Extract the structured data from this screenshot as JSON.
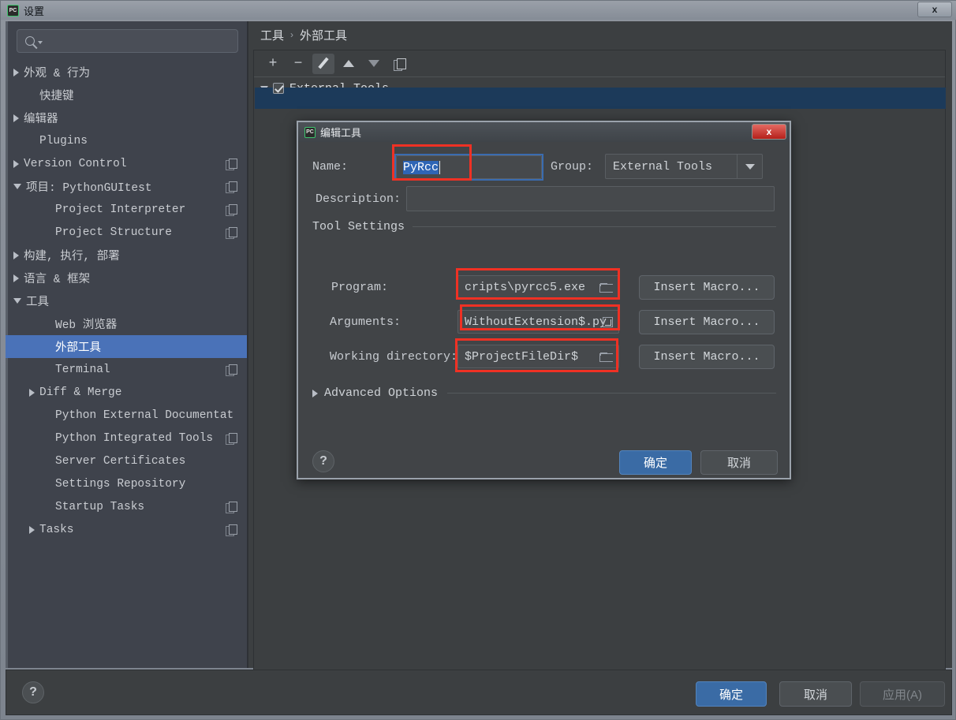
{
  "window": {
    "title": "设置",
    "close_label": "x",
    "app_icon": "PC"
  },
  "sidebar": {
    "search": {
      "placeholder": "",
      "value": ""
    },
    "items": [
      {
        "label": "外观 & 行为",
        "arrow": "right",
        "indent": 0,
        "copy": false,
        "selected": false
      },
      {
        "label": "快捷键",
        "arrow": "none",
        "indent": 1,
        "copy": false,
        "selected": false
      },
      {
        "label": "编辑器",
        "arrow": "right",
        "indent": 0,
        "copy": false,
        "selected": false
      },
      {
        "label": "Plugins",
        "arrow": "none",
        "indent": 1,
        "copy": false,
        "selected": false
      },
      {
        "label": "Version Control",
        "arrow": "right",
        "indent": 0,
        "copy": true,
        "selected": false
      },
      {
        "label": "项目: PythonGUItest",
        "arrow": "down",
        "indent": 0,
        "copy": true,
        "selected": false
      },
      {
        "label": "Project Interpreter",
        "arrow": "none",
        "indent": 2,
        "copy": true,
        "selected": false
      },
      {
        "label": "Project Structure",
        "arrow": "none",
        "indent": 2,
        "copy": true,
        "selected": false
      },
      {
        "label": "构建, 执行, 部署",
        "arrow": "right",
        "indent": 0,
        "copy": false,
        "selected": false
      },
      {
        "label": "语言 & 框架",
        "arrow": "right",
        "indent": 0,
        "copy": false,
        "selected": false
      },
      {
        "label": "工具",
        "arrow": "down",
        "indent": 0,
        "copy": false,
        "selected": false
      },
      {
        "label": "Web 浏览器",
        "arrow": "none",
        "indent": 2,
        "copy": false,
        "selected": false
      },
      {
        "label": "外部工具",
        "arrow": "none",
        "indent": 2,
        "copy": false,
        "selected": true
      },
      {
        "label": "Terminal",
        "arrow": "none",
        "indent": 2,
        "copy": true,
        "selected": false
      },
      {
        "label": "Diff & Merge",
        "arrow": "right",
        "indent": 1,
        "copy": false,
        "selected": false
      },
      {
        "label": "Python External Documentat",
        "arrow": "none",
        "indent": 2,
        "copy": false,
        "selected": false
      },
      {
        "label": "Python Integrated Tools",
        "arrow": "none",
        "indent": 2,
        "copy": true,
        "selected": false
      },
      {
        "label": "Server Certificates",
        "arrow": "none",
        "indent": 2,
        "copy": false,
        "selected": false
      },
      {
        "label": "Settings Repository",
        "arrow": "none",
        "indent": 2,
        "copy": false,
        "selected": false
      },
      {
        "label": "Startup Tasks",
        "arrow": "none",
        "indent": 2,
        "copy": true,
        "selected": false
      },
      {
        "label": "Tasks",
        "arrow": "right",
        "indent": 1,
        "copy": true,
        "selected": false
      }
    ]
  },
  "main": {
    "breadcrumb": {
      "parent": "工具",
      "separator": "›",
      "current": "外部工具"
    },
    "toolbar": {
      "add": "+",
      "remove": "−",
      "edit_icon": "pencil-icon",
      "move_up_icon": "arrow-up-icon",
      "move_down_icon": "arrow-down-icon",
      "copy_icon": "copy-icon"
    },
    "tree_root": {
      "label": "External Tools",
      "checked": true,
      "expanded": true
    }
  },
  "dialog": {
    "title": "编辑工具",
    "app_icon": "PC",
    "close_label": "x",
    "name": {
      "label": "Name:",
      "value": "PyRcc",
      "selected_text": "PyRcc"
    },
    "group": {
      "label": "Group:",
      "value": "External Tools"
    },
    "description": {
      "label": "Description:",
      "value": ""
    },
    "tool_settings_label": "Tool Settings",
    "program": {
      "label": "Program:",
      "value": "cripts\\pyrcc5.exe",
      "macro_button": "Insert Macro...",
      "icon": "folder-icon"
    },
    "arguments": {
      "label": "Arguments:",
      "value": "WithoutExtension$.py",
      "macro_button": "Insert Macro...",
      "icon": "expand-icon"
    },
    "working_directory": {
      "label": "Working directory:",
      "value": "$ProjectFileDir$",
      "macro_button": "Insert Macro...",
      "icon": "folder-icon"
    },
    "advanced_options_label": "Advanced Options",
    "help_label": "?",
    "ok_label": "确定",
    "cancel_label": "取消"
  },
  "footer": {
    "help_label": "?",
    "ok_label": "确定",
    "cancel_label": "取消",
    "apply_label": "应用(A)"
  },
  "colors": {
    "accent_blue": "#3a6ba5",
    "selection_blue": "#4a72b8",
    "annotation_red": "#ef3124",
    "row_selected_navy": "#1c3a5a",
    "panel_bg": "#3c3f41",
    "sidebar_bg": "#3f434c",
    "dialog_bg": "#414447"
  }
}
